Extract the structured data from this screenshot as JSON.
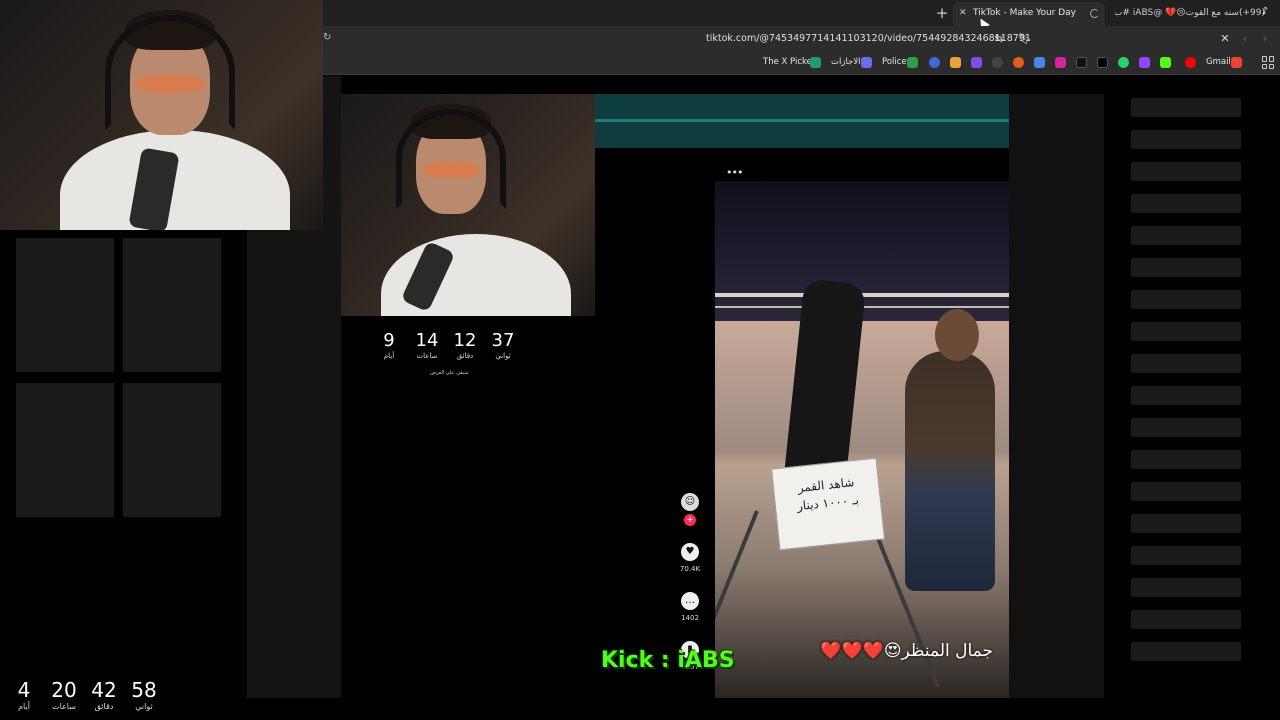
{
  "browser": {
    "active_tab": {
      "title": "TikTok - Make Your Day"
    },
    "other_tab": {
      "title": "(99+)سنه مع القوت😢💔 @iABS #ب..."
    },
    "url": "tiktok.com/@7453497714141103120/video/7544928432468118791",
    "bookmarks": [
      {
        "label": "The X Picker",
        "icon": "x-picker-icon",
        "color": "#1e9e6a"
      },
      {
        "label": "الاجازات",
        "icon": "list-icon",
        "color": "#6b6bf0"
      },
      {
        "label": "Police",
        "icon": "plus-square-icon",
        "color": "#2ea043"
      },
      {
        "label": "Gmail",
        "icon": "gmail-icon",
        "color": "#ea4335"
      }
    ]
  },
  "stream": {
    "kick_overlay": "Kick : iABS",
    "timer_main": {
      "days": "4",
      "hours": "20",
      "minutes": "42",
      "seconds": "58",
      "days_label": "أيام",
      "hours_label": "ساعات",
      "minutes_label": "دقائق",
      "seconds_label": "ثواني"
    },
    "timer_inner": {
      "days": "9",
      "hours": "14",
      "minutes": "12",
      "seconds": "37",
      "days_label": "أيام",
      "hours_label": "ساعات",
      "minutes_label": "دقائق",
      "seconds_label": "ثواني",
      "subtitle": "متبقي على العرض"
    }
  },
  "tiktok": {
    "sign_text_line1": "شاهد القمر",
    "sign_text_line2": "بـ ١٠٠٠ دينار",
    "caption": "جمال المنظر😍",
    "caption_hearts": "❤️❤️❤️",
    "likes": "70.4K",
    "comments": "1402",
    "saves": "3667"
  }
}
